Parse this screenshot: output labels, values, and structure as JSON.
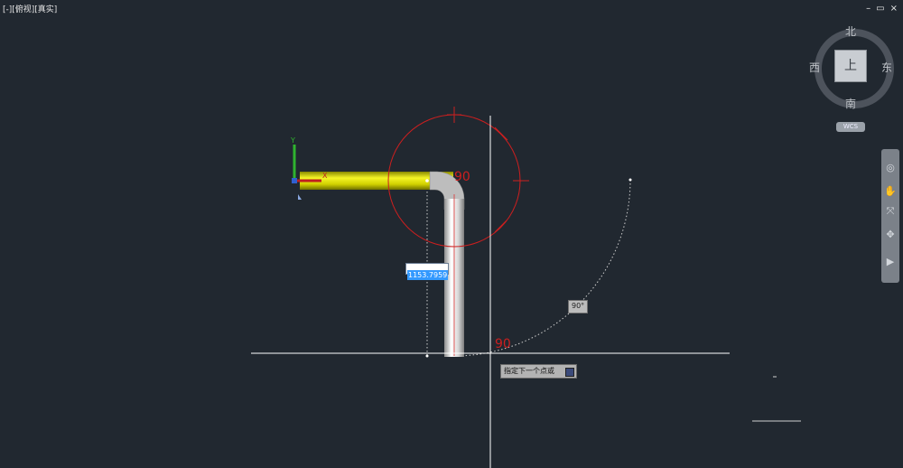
{
  "viewport": {
    "label": "[-][俯视][真实]",
    "window_controls": {
      "minimize": "–",
      "restore": "▭",
      "close": "×"
    }
  },
  "scene": {
    "arc_label": "90",
    "angle_label": "90"
  },
  "dynamic_input": {
    "value": "1153.7959",
    "angle_tooltip": "90°"
  },
  "command_prompt": {
    "text": "指定下一个点或"
  },
  "viewcube": {
    "north": "北",
    "south": "南",
    "east": "东",
    "west": "西",
    "face": "上",
    "wcs": "WCS"
  },
  "ucs": {
    "y_label": "Y",
    "x_label": "X"
  },
  "navbar": {
    "icons": [
      "steering-wheel-icon",
      "pan-icon",
      "zoom-extents-icon",
      "orbit-icon",
      "showmotion-icon"
    ]
  },
  "colors": {
    "background": "#212830",
    "pipe_yellow": "#d8d800",
    "pipe_white": "#e0e0e0",
    "circle_red": "#cc1f1f",
    "crosshair": "#ffffff"
  }
}
